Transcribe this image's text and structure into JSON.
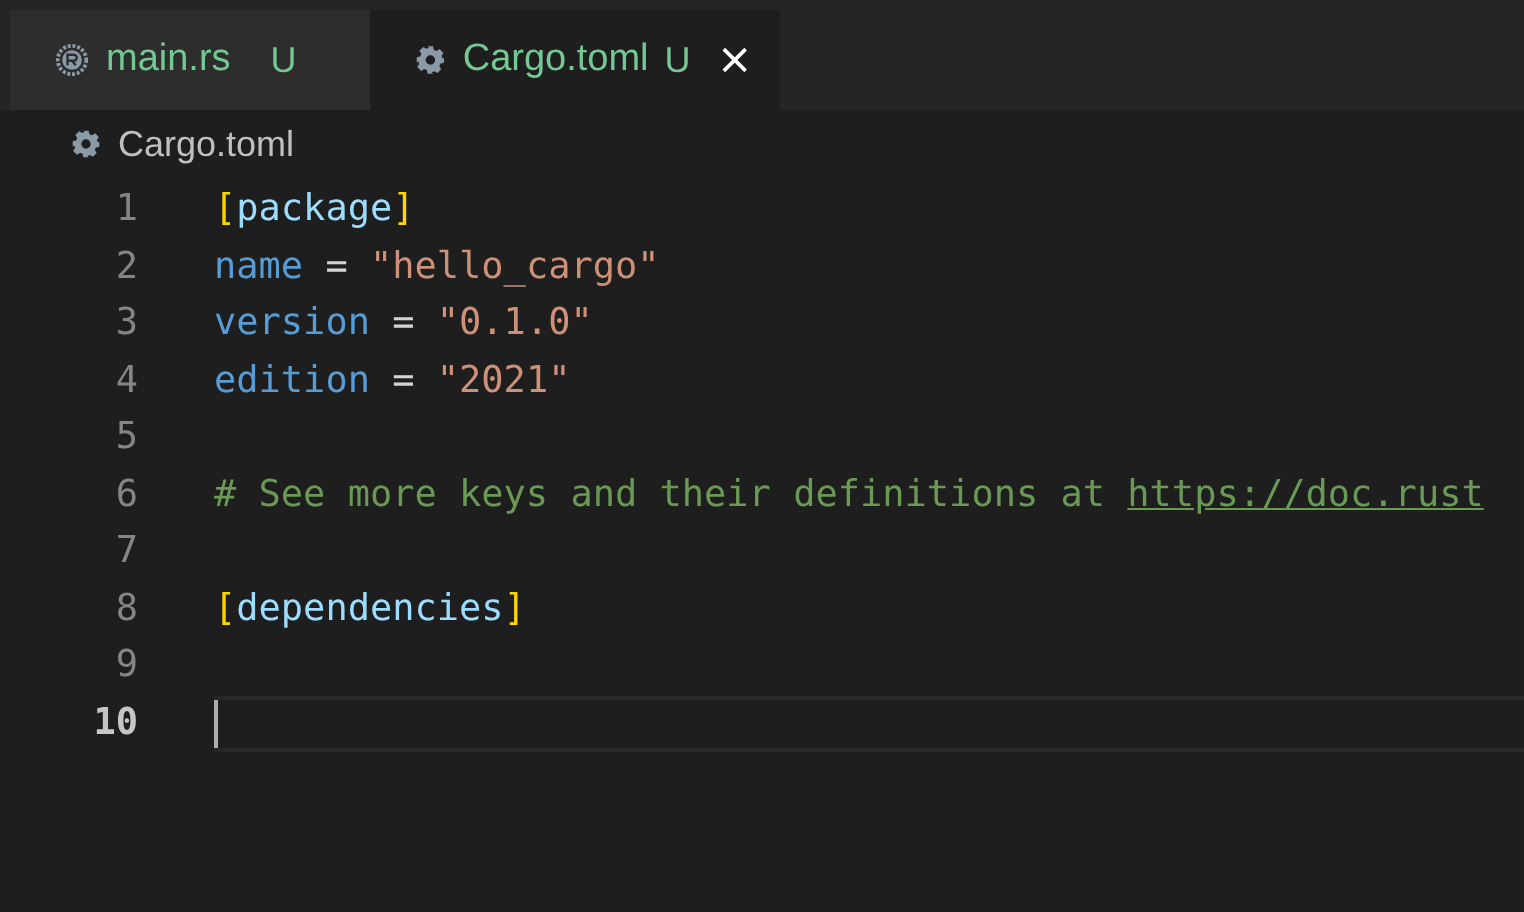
{
  "tabs": [
    {
      "label": "main.rs",
      "kind": "rust",
      "status": "U",
      "selected": false
    },
    {
      "label": "Cargo.toml",
      "kind": "config",
      "status": "U",
      "selected": true
    }
  ],
  "breadcrumb": {
    "kind": "config",
    "label": "Cargo.toml"
  },
  "editor": {
    "lines": [
      {
        "number": "1",
        "current": false,
        "tokens": [
          {
            "kind": "bracket",
            "text": "["
          },
          {
            "kind": "table",
            "text": "package"
          },
          {
            "kind": "bracket",
            "text": "]"
          }
        ]
      },
      {
        "number": "2",
        "current": false,
        "tokens": [
          {
            "kind": "key",
            "text": "name"
          },
          {
            "kind": "op",
            "text": " = "
          },
          {
            "kind": "string",
            "text": "\"hello_cargo\""
          }
        ]
      },
      {
        "number": "3",
        "current": false,
        "tokens": [
          {
            "kind": "key",
            "text": "version"
          },
          {
            "kind": "op",
            "text": " = "
          },
          {
            "kind": "string",
            "text": "\"0.1.0\""
          }
        ]
      },
      {
        "number": "4",
        "current": false,
        "tokens": [
          {
            "kind": "key",
            "text": "edition"
          },
          {
            "kind": "op",
            "text": " = "
          },
          {
            "kind": "string",
            "text": "\"2021\""
          }
        ]
      },
      {
        "number": "5",
        "current": false
      },
      {
        "number": "6",
        "current": false,
        "tokens": [
          {
            "kind": "comment",
            "text": "# See more keys and their definitions at "
          },
          {
            "kind": "link",
            "text": "https://doc.rust"
          }
        ]
      },
      {
        "number": "7",
        "current": false
      },
      {
        "number": "8",
        "current": false,
        "tokens": [
          {
            "kind": "bracket",
            "text": "["
          },
          {
            "kind": "table",
            "text": "dependencies"
          },
          {
            "kind": "bracket",
            "text": "]"
          }
        ]
      },
      {
        "number": "9",
        "current": false
      },
      {
        "number": "10",
        "current": true
      }
    ]
  }
}
